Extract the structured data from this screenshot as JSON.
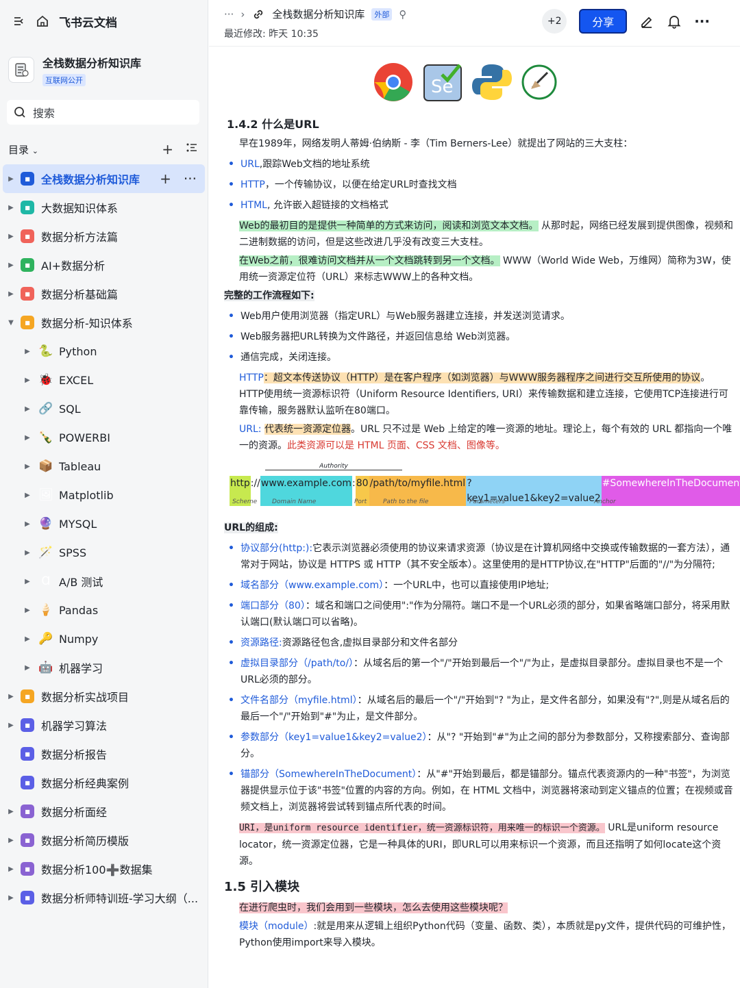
{
  "app": {
    "name": "飞书云文档"
  },
  "space": {
    "title": "全栈数据分析知识库",
    "tag": "互联网公开"
  },
  "search": {
    "label": "搜索"
  },
  "toc": {
    "label": "目录"
  },
  "tree": [
    {
      "label": "全栈数据分析知识库",
      "level": 0,
      "active": true,
      "icon": "link-icon",
      "color": "#1f5bd9"
    },
    {
      "label": "大数据知识体系",
      "level": 0,
      "icon": "lightning-icon",
      "color": "#1fb8a6"
    },
    {
      "label": "数据分析方法篇",
      "level": 0,
      "icon": "doc-icon",
      "color": "#f0635a"
    },
    {
      "label": "AI+数据分析",
      "level": 0,
      "icon": "home-icon",
      "color": "#2fb35e"
    },
    {
      "label": "数据分析基础篇",
      "level": 0,
      "icon": "doc-icon",
      "color": "#f0635a"
    },
    {
      "label": "数据分析-知识体系",
      "level": 0,
      "expanded": true,
      "icon": "box-icon",
      "color": "#f5a623"
    },
    {
      "label": "Python",
      "level": 1,
      "icon": "snake-icon",
      "glyph": "🐍"
    },
    {
      "label": "EXCEL",
      "level": 1,
      "icon": "bug-icon",
      "glyph": "🐞"
    },
    {
      "label": "SQL",
      "level": 1,
      "icon": "nodes-icon",
      "glyph": "🔗"
    },
    {
      "label": "POWERBI",
      "level": 1,
      "icon": "bottle-icon",
      "glyph": "🍾"
    },
    {
      "label": "Tableau",
      "level": 1,
      "icon": "package-icon",
      "glyph": "📦"
    },
    {
      "label": "Matplotlib",
      "level": 1,
      "icon": "picture-icon",
      "glyph": "🖼"
    },
    {
      "label": "MYSQL",
      "level": 1,
      "icon": "ball-icon",
      "glyph": "🔮"
    },
    {
      "label": "SPSS",
      "level": 1,
      "icon": "wand-icon",
      "glyph": "🪄"
    },
    {
      "label": "A/B 测试",
      "level": 1,
      "icon": "c-icon",
      "glyph": "Ɑ"
    },
    {
      "label": "Pandas",
      "level": 1,
      "icon": "icecream-icon",
      "glyph": "🍦"
    },
    {
      "label": "Numpy",
      "level": 1,
      "icon": "key-icon",
      "glyph": "🔑"
    },
    {
      "label": "机器学习",
      "level": 1,
      "icon": "robot-icon",
      "glyph": "🤖"
    },
    {
      "label": "数据分析实战项目",
      "level": 0,
      "icon": "box-icon",
      "color": "#f5a623"
    },
    {
      "label": "机器学习算法",
      "level": 0,
      "icon": "window-icon",
      "color": "#5b5fe6"
    },
    {
      "label": "数据分析报告",
      "level": 0,
      "nocaret": true,
      "icon": "window-icon",
      "color": "#5b5fe6"
    },
    {
      "label": "数据分析经典案例",
      "level": 0,
      "nocaret": true,
      "icon": "window-icon",
      "color": "#5b5fe6"
    },
    {
      "label": "数据分析面经",
      "level": 0,
      "icon": "list-icon",
      "color": "#8a63d2"
    },
    {
      "label": "数据分析简历模版",
      "level": 0,
      "icon": "list-icon",
      "color": "#8a63d2"
    },
    {
      "label": "数据分析100➕数据集",
      "level": 0,
      "icon": "list-icon",
      "color": "#8a63d2"
    },
    {
      "label": "数据分析师特训班-学习大纲（...",
      "level": 0,
      "icon": "clock-icon",
      "color": "#5b5fe6"
    }
  ],
  "header": {
    "dots": "···",
    "title": "全栈数据分析知识库",
    "tag": "外部",
    "lastmod": "最近修改: 昨天 10:35",
    "collab": "+2",
    "share": "分享"
  },
  "doc": {
    "h_142": "1.4.2 什么是URL",
    "p1": "早在1989年，网络发明人蒂姆·伯纳斯 - 李（Tim Berners-Lee）就提出了网站的三大支柱：",
    "b1": [
      {
        "k": "URL",
        "t": ",跟踪Web文档的地址系统"
      },
      {
        "k": "HTTP",
        "t": "，一个传输协议，以便在给定URL时查找文档"
      },
      {
        "k": "HTML",
        "t": ", 允许嵌入超链接的文档格式"
      }
    ],
    "p2_hl": "Web的最初目的是提供一种简单的方式来访问，阅读和浏览文本文档。",
    "p2_rest": "从那时起，网络已经发展到提供图像，视频和二进制数据的访问，但是这些改进几乎没有改变三大支柱。",
    "p3_hl": "在Web之前，很难访问文档并从一个文档跳转到另一个文档。",
    "p3_rest": "WWW（World Wide Web，万维网）简称为3W，使用统一资源定位符（URL）来标志WWW上的各种文档。",
    "flow_title": "完整的工作流程如下:",
    "b2": [
      "Web用户使用浏览器（指定URL）与Web服务器建立连接，并发送浏览请求。",
      "Web服务器把URL转换为文件路径，并返回信息给 Web浏览器。",
      "通信完成，关闭连接。"
    ],
    "http_k": "HTTP",
    "http_hl": "：超文本传送协议（HTTP）是在客户程序（如浏览器）与WWW服务器程序之间进行交互所使用的协议",
    "http_rest": "。HTTP使用统一资源标识符（Uniform Resource Identifiers, URI）来传输数据和建立连接，它使用TCP连接进行可靠传输，服务器默认监听在80端口。",
    "url_k": "URL:",
    "url_hl": "代表统一资源定位器",
    "url_rest": "。URL 只不过是 Web 上给定的唯一资源的地址。理论上，每个有效的 URL 都指向一个唯一的资源。",
    "url_red": "此类资源可以是 HTML 页面、CSS 文档、图像等。",
    "urlfig": {
      "authority": "Authority",
      "scheme": "http",
      "sep": "://",
      "domain": "www.example.com",
      "colon": ":",
      "port": "80",
      "path": "/path/to/myfile.html",
      "params": "?key1=value1&key2=value2",
      "anchor": "#SomewhereInTheDocument",
      "l_scheme": "Scheme",
      "l_domain": "Domain Name",
      "l_port": "Port",
      "l_path": "Path to the file",
      "l_params": "Parameters",
      "l_anchor": "Anchor"
    },
    "compose_title": "URL的组成:",
    "b3": [
      {
        "k": "协议部分(http:):",
        "t": "它表示浏览器必须使用的协议来请求资源（协议是在计算机网络中交换或传输数据的一套方法），通常对于网站，协议是 HTTPS 或 HTTP（其不安全版本）。这里使用的是HTTP协议,在\"HTTP\"后面的\"//\"为分隔符;"
      },
      {
        "k": "域名部分（www.example.com）",
        "t": "：一个URL中，也可以直接使用IP地址;"
      },
      {
        "k": "端口部分（80）",
        "t": "：域名和端口之间使用\":\"作为分隔符。端口不是一个URL必须的部分，如果省略端口部分，将采用默认端口(默认端口可以省略)。"
      },
      {
        "k": "资源路径:",
        "t": "资源路径包含,虚拟目录部分和文件名部分"
      },
      {
        "k": "虚拟目录部分（/path/to/）",
        "t": "：从域名后的第一个\"/\"开始到最后一个\"/\"为止，是虚拟目录部分。虚拟目录也不是一个URL必须的部分。"
      },
      {
        "k": "文件名部分（myfile.html）",
        "t": "：从域名后的最后一个\"/\"开始到\"? \"为止，是文件名部分，如果没有\"?\",则是从域名后的最后一个\"/\"开始到\"#\"为止，是文件部分。"
      },
      {
        "k": "参数部分（key1=value1&key2=value2）",
        "t": "：从\"? \"开始到\"#\"为止之间的部分为参数部分，又称搜索部分、查询部分。"
      },
      {
        "k": "锚部分（SomewhereInTheDocument）",
        "t": "：从\"#\"开始到最后，都是锚部分。锚点代表资源内的一种\"书签\"，为浏览器提供显示位于该\"书签\"位置的内容的方向。例如，在 HTML 文档中，浏览器将滚动到定义锚点的位置；在视频或音频文档上，浏览器将尝试转到锚点所代表的时间。"
      }
    ],
    "uri_hl": "URI，是uniform resource identifier，统一资源标识符，用来唯一的标识一个资源。",
    "uri_rest": "URL是uniform resource locator，统一资源定位器，它是一种具体的URI，即URL可以用来标识一个资源，而且还指明了如何locate这个资源。",
    "h_15": "1.5 引入模块",
    "q15": "在进行爬虫时，我们会用到一些模块，怎么去使用这些模块呢？",
    "mod_k": "模块（module）",
    "mod_t": ":就是用来从逻辑上组织Python代码（变量、函数、类），本质就是py文件，提供代码的可维护性，Python使用import来导入模块。"
  }
}
